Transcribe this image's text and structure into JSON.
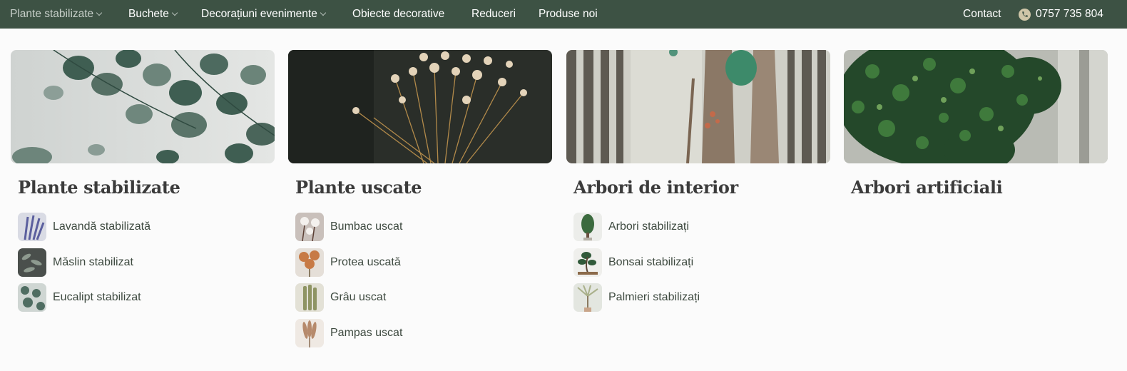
{
  "nav": {
    "items": [
      {
        "label": "Plante stabilizate"
      },
      {
        "label": "Buchete"
      },
      {
        "label": "Decorațiuni evenimente"
      },
      {
        "label": "Obiecte decorative"
      },
      {
        "label": "Reduceri"
      },
      {
        "label": "Produse noi"
      }
    ],
    "contact": "Contact",
    "phone": "0757 735 804"
  },
  "colors": {
    "nav_bg": "#3d5244",
    "page_bg": "#fbfbfb",
    "title": "#3b3b3b",
    "link": "#3e4a40"
  },
  "categories": [
    {
      "title": "Plante stabilizate",
      "image": "eucalyptus-leaves-photo",
      "items": [
        {
          "label": "Lavandă stabilizată",
          "thumb": "lavender-photo"
        },
        {
          "label": "Măslin stabilizat",
          "thumb": "olive-branch-photo"
        },
        {
          "label": "Eucalipt stabilizat",
          "thumb": "eucalyptus-photo"
        }
      ]
    },
    {
      "title": "Plante uscate",
      "image": "dried-flowers-photo",
      "items": [
        {
          "label": "Bumbac uscat",
          "thumb": "cotton-photo"
        },
        {
          "label": "Protea uscată",
          "thumb": "protea-photo"
        },
        {
          "label": "Grâu uscat",
          "thumb": "wheat-photo"
        },
        {
          "label": "Pampas uscat",
          "thumb": "pampas-photo"
        }
      ]
    },
    {
      "title": "Arbori de interior",
      "image": "tree-trunk-photo",
      "items": [
        {
          "label": "Arbori stabilizați",
          "thumb": "stabilized-tree-photo"
        },
        {
          "label": "Bonsai stabilizați",
          "thumb": "bonsai-photo"
        },
        {
          "label": "Palmieri stabilizați",
          "thumb": "palm-photo"
        }
      ]
    },
    {
      "title": "Arbori artificiali",
      "image": "artificial-tree-photo",
      "items": []
    }
  ]
}
